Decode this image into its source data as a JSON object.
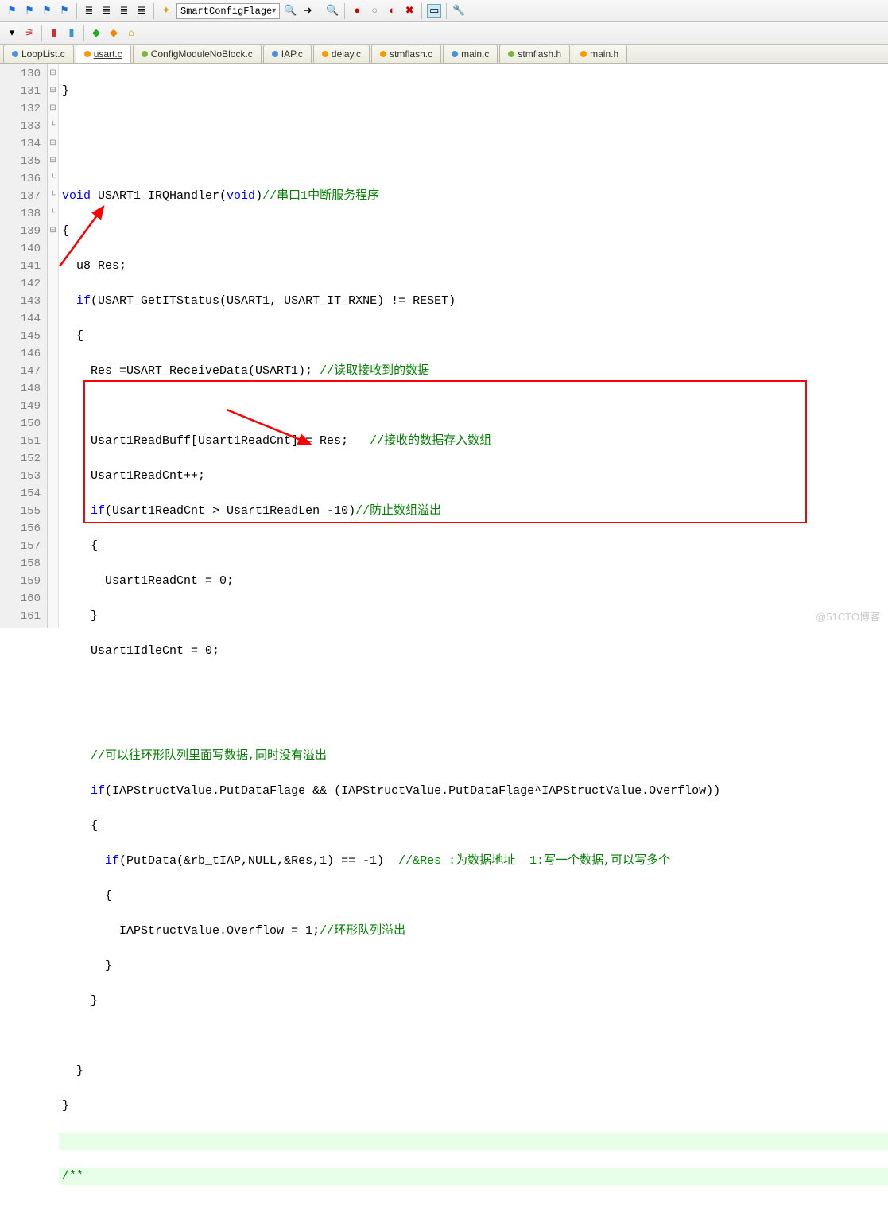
{
  "toolbar": {
    "combo_value": "SmartConfigFlage"
  },
  "tabs": [
    {
      "label": "LoopList.c",
      "color": "dot-blue",
      "active": false
    },
    {
      "label": "usart.c",
      "color": "dot-orange",
      "active": true
    },
    {
      "label": "ConfigModuleNoBlock.c",
      "color": "dot-green",
      "active": false
    },
    {
      "label": "IAP.c",
      "color": "dot-blue",
      "active": false
    },
    {
      "label": "delay.c",
      "color": "dot-orange",
      "active": false
    },
    {
      "label": "stmflash.c",
      "color": "dot-orange",
      "active": false
    },
    {
      "label": "main.c",
      "color": "dot-blue",
      "active": false
    },
    {
      "label": "stmflash.h",
      "color": "dot-green",
      "active": false
    },
    {
      "label": "main.h",
      "color": "dot-orange",
      "active": false
    }
  ],
  "lines": {
    "start": 130,
    "l130": "}",
    "l133_kw1": "void",
    "l133_fn": " USART1_IRQHandler(",
    "l133_kw2": "void",
    "l133_rest": ")",
    "l133_cm": "//串口1中断服务程序",
    "l134": "{",
    "l135": "  u8 Res;",
    "l136_a": "  ",
    "l136_kw": "if",
    "l136_b": "(USART_GetITStatus(USART1, USART_IT_RXNE) != RESET)",
    "l137": "  {",
    "l138_a": "    Res =USART_ReceiveData(USART1); ",
    "l138_cm": "//读取接收到的数据",
    "l140_a": "    Usart1ReadBuff[Usart1ReadCnt] = Res;   ",
    "l140_cm": "//接收的数据存入数组",
    "l141": "    Usart1ReadCnt++;",
    "l142_a": "    ",
    "l142_kw": "if",
    "l142_b": "(Usart1ReadCnt > Usart1ReadLen -",
    "l142_num": "10",
    "l142_c": ")",
    "l142_cm": "//防止数组溢出",
    "l143": "    {",
    "l144_a": "      Usart1ReadCnt = ",
    "l144_num": "0",
    "l144_b": ";",
    "l145": "    }",
    "l146_a": "    Usart1IdleCnt = ",
    "l146_num": "0",
    "l146_b": ";",
    "l149_cm": "    //可以往环形队列里面写数据,同时没有溢出",
    "l150_a": "    ",
    "l150_kw": "if",
    "l150_b": "(IAPStructValue.PutDataFlage && (IAPStructValue.PutDataFlage^IAPStructValue.Overflow))",
    "l151": "    {",
    "l152_a": "      ",
    "l152_kw": "if",
    "l152_b": "(PutData(&rb_tIAP,NULL,&Res,",
    "l152_num": "1",
    "l152_c": ") == -",
    "l152_num2": "1",
    "l152_d": ")  ",
    "l152_cm": "//&Res :为数据地址  1:写一个数据,可以写多个",
    "l153": "      {",
    "l154_a": "        IAPStructValue.Overflow = ",
    "l154_num": "1",
    "l154_b": ";",
    "l154_cm": "//环形队列溢出",
    "l155": "      }",
    "l156": "    }",
    "l158": "  }",
    "l159": "}",
    "l161_cm": "/**"
  },
  "watermark": "@51CTO博客"
}
